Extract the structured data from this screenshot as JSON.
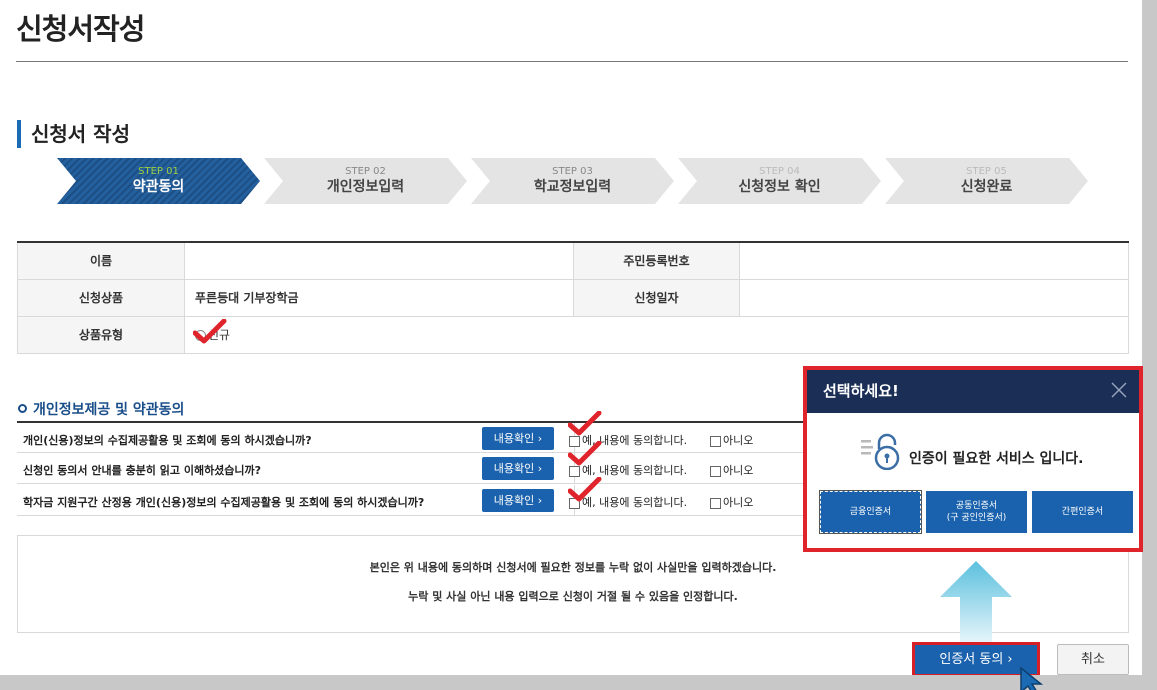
{
  "page": {
    "title": "신청서작성",
    "section_title": "신청서 작성"
  },
  "steps": [
    {
      "num": "STEP 01",
      "label": "약관동의",
      "active": true
    },
    {
      "num": "STEP 02",
      "label": "개인정보입력",
      "active": false
    },
    {
      "num": "STEP 03",
      "label": "학교정보입력",
      "active": false
    },
    {
      "num": "STEP 04",
      "label": "신청정보 확인",
      "active": false
    },
    {
      "num": "STEP 05",
      "label": "신청완료",
      "active": false
    }
  ],
  "info": {
    "name_label": "이름",
    "name_value": "",
    "ssn_label": "주민등록번호",
    "ssn_value": "",
    "product_label": "신청상품",
    "product_value": "푸른등대 기부장학금",
    "date_label": "신청일자",
    "date_value": "",
    "type_label": "상품유형",
    "type_value": "신규"
  },
  "consent": {
    "title": "개인정보제공 및 약관동의",
    "detail_button": "내용확인",
    "yes_label": "예, 내용에 동의합니다.",
    "no_label": "아니오",
    "questions": [
      "개인(신용)정보의 수집제공활용 및 조회에 동의 하시겠습니까?",
      "신청인 동의서 안내를 충분히 읽고 이해하셨습니까?",
      "학자금 지원구간 산정용 개인(신용)정보의 수집제공활용 및 조회에 동의 하시겠습니까?"
    ]
  },
  "notice": {
    "line1": "본인은 위 내용에 동의하며 신청서에 필요한 정보를 누락 없이 사실만을 입력하겠습니다.",
    "line2": "누락 및 사실 아닌 내용 입력으로 신청이 거절 될 수 있음을 인정합니다."
  },
  "buttons": {
    "agree": "인증서 동의",
    "cancel": "취소"
  },
  "popup": {
    "title": "선택하세요!",
    "message": "인증이 필요한 서비스 입니다.",
    "options": [
      {
        "line1": "금융인증서",
        "line2": ""
      },
      {
        "line1": "공동인증서",
        "line2": "(구 공인인증서)"
      },
      {
        "line1": "간편인증서",
        "line2": ""
      }
    ]
  },
  "colors": {
    "primary": "#1a62ad",
    "highlight": "#e0242b",
    "popup_header": "#1b2f56",
    "step_active": "#1c4f86"
  }
}
